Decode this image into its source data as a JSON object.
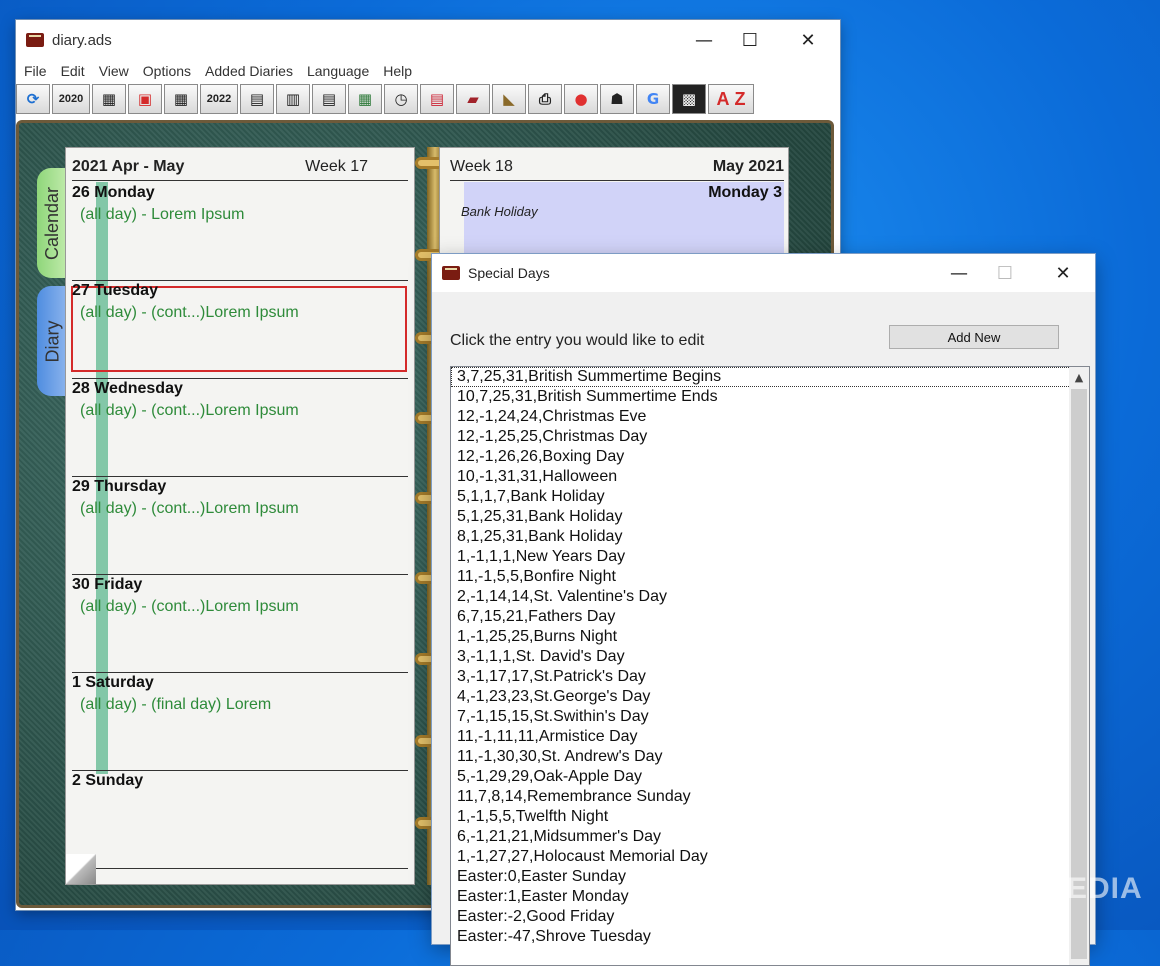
{
  "main_window": {
    "title": "diary.ads",
    "controls": {
      "minimize": "—",
      "maximize": "☐",
      "close": "✕"
    },
    "menu": [
      "File",
      "Edit",
      "View",
      "Options",
      "Added Diaries",
      "Language",
      "Help"
    ],
    "toolbar": {
      "refresh_icon": "refresh-icon",
      "year_prev": "2020",
      "year_next": "2022",
      "az_a": "A",
      "az_z": "Z"
    }
  },
  "diary": {
    "tabs": {
      "calendar": "Calendar",
      "diary": "Diary"
    },
    "left_page": {
      "header": "2021 Apr - May",
      "week": "Week 17",
      "days": [
        {
          "label": "26 Monday",
          "entry": "(all day) - Lorem Ipsum"
        },
        {
          "label": "27 Tuesday",
          "entry": "(all day) - (cont...)Lorem Ipsum"
        },
        {
          "label": "28 Wednesday",
          "entry": "(all day) - (cont...)Lorem Ipsum"
        },
        {
          "label": "29 Thursday",
          "entry": "(all day) - (cont...)Lorem Ipsum"
        },
        {
          "label": "30 Friday",
          "entry": "(all day) - (cont...)Lorem Ipsum"
        },
        {
          "label": "1 Saturday",
          "entry": "(all day) - (final day) Lorem"
        },
        {
          "label": "2 Sunday",
          "entry": ""
        }
      ]
    },
    "right_page": {
      "week": "Week 18",
      "header": "May 2021",
      "day": "Monday 3",
      "holiday": "Bank Holiday"
    }
  },
  "dialog": {
    "title": "Special Days",
    "controls": {
      "minimize": "—",
      "maximize": "☐",
      "close": "✕"
    },
    "prompt": "Click the entry you would like to edit",
    "add_button": "Add New",
    "items": [
      "3,7,25,31,British Summertime Begins",
      "10,7,25,31,British Summertime Ends",
      "12,-1,24,24,Christmas Eve",
      "12,-1,25,25,Christmas Day",
      "12,-1,26,26,Boxing Day",
      "10,-1,31,31,Halloween",
      "5,1,1,7,Bank Holiday",
      "5,1,25,31,Bank Holiday",
      "8,1,25,31,Bank Holiday",
      "1,-1,1,1,New Years Day",
      "11,-1,5,5,Bonfire Night",
      "2,-1,14,14,St. Valentine's Day",
      "6,7,15,21,Fathers Day",
      "1,-1,25,25,Burns Night",
      "3,-1,1,1,St. David's Day",
      "3,-1,17,17,St.Patrick's Day",
      "4,-1,23,23,St.George's Day",
      "7,-1,15,15,St.Swithin's Day",
      "11,-1,11,11,Armistice Day",
      "11,-1,30,30,St. Andrew's Day",
      "5,-1,29,29,Oak-Apple Day",
      "11,7,8,14,Remembrance Sunday",
      "1,-1,5,5,Twelfth Night",
      "6,-1,21,21,Midsummer's Day",
      "1,-1,27,27,Holocaust Memorial Day",
      "Easter:0,Easter Sunday",
      "Easter:1,Easter Monday",
      "Easter:-2,Good Friday",
      "Easter:-47,Shrove Tuesday"
    ]
  },
  "watermark": "SOFTPEDIA"
}
